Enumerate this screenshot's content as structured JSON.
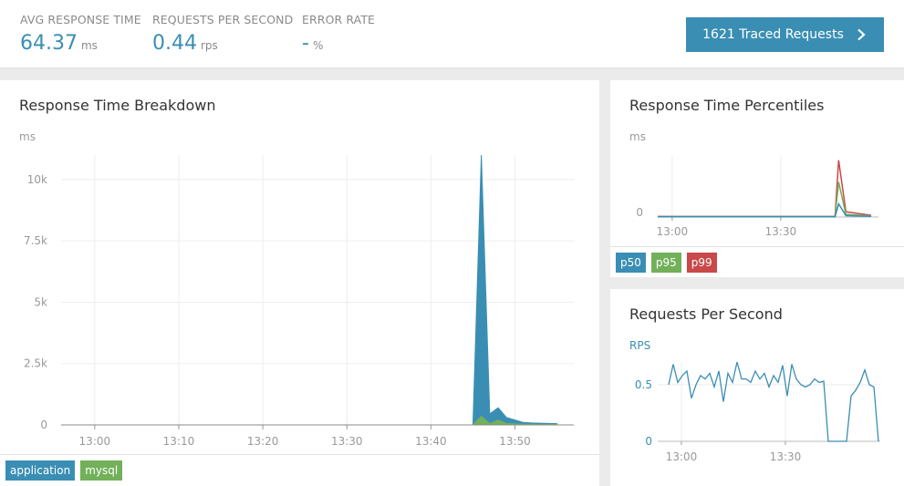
{
  "metrics": {
    "avg_response": {
      "label": "AVG RESPONSE TIME",
      "value": "64.37",
      "unit": "ms"
    },
    "rps": {
      "label": "REQUESTS PER SECOND",
      "value": "0.44",
      "unit": "rps"
    },
    "error_rate": {
      "label": "ERROR RATE",
      "value": "-",
      "unit": "%"
    }
  },
  "traced_button": {
    "label": "1621 Traced Requests",
    "icon": "chevron-right-icon"
  },
  "colors": {
    "accent": "#3a8eb4",
    "application": "#3a8eb4",
    "mysql": "#72b05a",
    "p99": "#c9484a"
  },
  "breakdown": {
    "title": "Response Time Breakdown",
    "unit": "ms",
    "legend": [
      {
        "label": "application",
        "color": "#3a8eb4"
      },
      {
        "label": "mysql",
        "color": "#72b05a"
      }
    ],
    "chart_data": {
      "type": "area",
      "ylabel": "ms",
      "ylim": [
        0,
        11000
      ],
      "y_ticks": [
        "0",
        "2.5k",
        "5k",
        "7.5k",
        "10k"
      ],
      "x_ticks": [
        "13:00",
        "13:10",
        "13:20",
        "13:30",
        "13:40",
        "13:50"
      ],
      "series": [
        {
          "name": "application",
          "x": [
            "12:56",
            "13:45",
            "13:46",
            "13:47",
            "13:48",
            "13:49",
            "13:50",
            "13:51",
            "13:52",
            "13:53",
            "13:54",
            "13:55"
          ],
          "values": [
            0,
            0,
            11000,
            450,
            700,
            300,
            200,
            100,
            80,
            70,
            60,
            50
          ]
        },
        {
          "name": "mysql",
          "x": [
            "12:56",
            "13:45",
            "13:46",
            "13:47",
            "13:48",
            "13:49",
            "13:50",
            "13:51",
            "13:52",
            "13:53",
            "13:54",
            "13:55"
          ],
          "values": [
            0,
            0,
            350,
            50,
            200,
            60,
            40,
            30,
            25,
            20,
            20,
            20
          ]
        }
      ]
    }
  },
  "percentiles": {
    "title": "Response Time Percentiles",
    "unit": "ms",
    "legend": [
      {
        "label": "p50",
        "color": "#3a8eb4"
      },
      {
        "label": "p95",
        "color": "#72b05a"
      },
      {
        "label": "p99",
        "color": "#c9484a"
      }
    ],
    "chart_data": {
      "type": "line",
      "ylabel": "ms",
      "y_ticks": [
        "0"
      ],
      "x_ticks": [
        "13:00",
        "13:30"
      ],
      "series": [
        {
          "name": "p50",
          "x": [
            "12:56",
            "13:45",
            "13:46",
            "13:48",
            "13:55"
          ],
          "values": [
            20,
            20,
            1500,
            150,
            80
          ]
        },
        {
          "name": "p95",
          "x": [
            "12:56",
            "13:45",
            "13:46",
            "13:48",
            "13:55"
          ],
          "values": [
            40,
            40,
            4000,
            300,
            150
          ]
        },
        {
          "name": "p99",
          "x": [
            "12:56",
            "13:45",
            "13:46",
            "13:48",
            "13:55"
          ],
          "values": [
            60,
            60,
            6500,
            600,
            200
          ]
        }
      ]
    }
  },
  "rps_panel": {
    "title": "Requests Per Second",
    "unit": "RPS",
    "chart_data": {
      "type": "line",
      "ylabel": "RPS",
      "ylim": [
        0,
        0.7
      ],
      "y_ticks": [
        "0",
        "0.5"
      ],
      "x_ticks": [
        "13:00",
        "13:30"
      ],
      "series": [
        {
          "name": "rps",
          "values": [
            0.5,
            0.68,
            0.52,
            0.58,
            0.62,
            0.38,
            0.5,
            0.58,
            0.55,
            0.6,
            0.48,
            0.62,
            0.35,
            0.6,
            0.52,
            0.7,
            0.55,
            0.55,
            0.52,
            0.62,
            0.55,
            0.6,
            0.48,
            0.58,
            0.52,
            0.67,
            0.4,
            0.68,
            0.55,
            0.5,
            0.48,
            0.5,
            0.55,
            0.52,
            0.53,
            0.0,
            0.0,
            0.0,
            0.0,
            0.0,
            0.4,
            0.45,
            0.52,
            0.63,
            0.5,
            0.48,
            0.0
          ]
        }
      ]
    }
  }
}
